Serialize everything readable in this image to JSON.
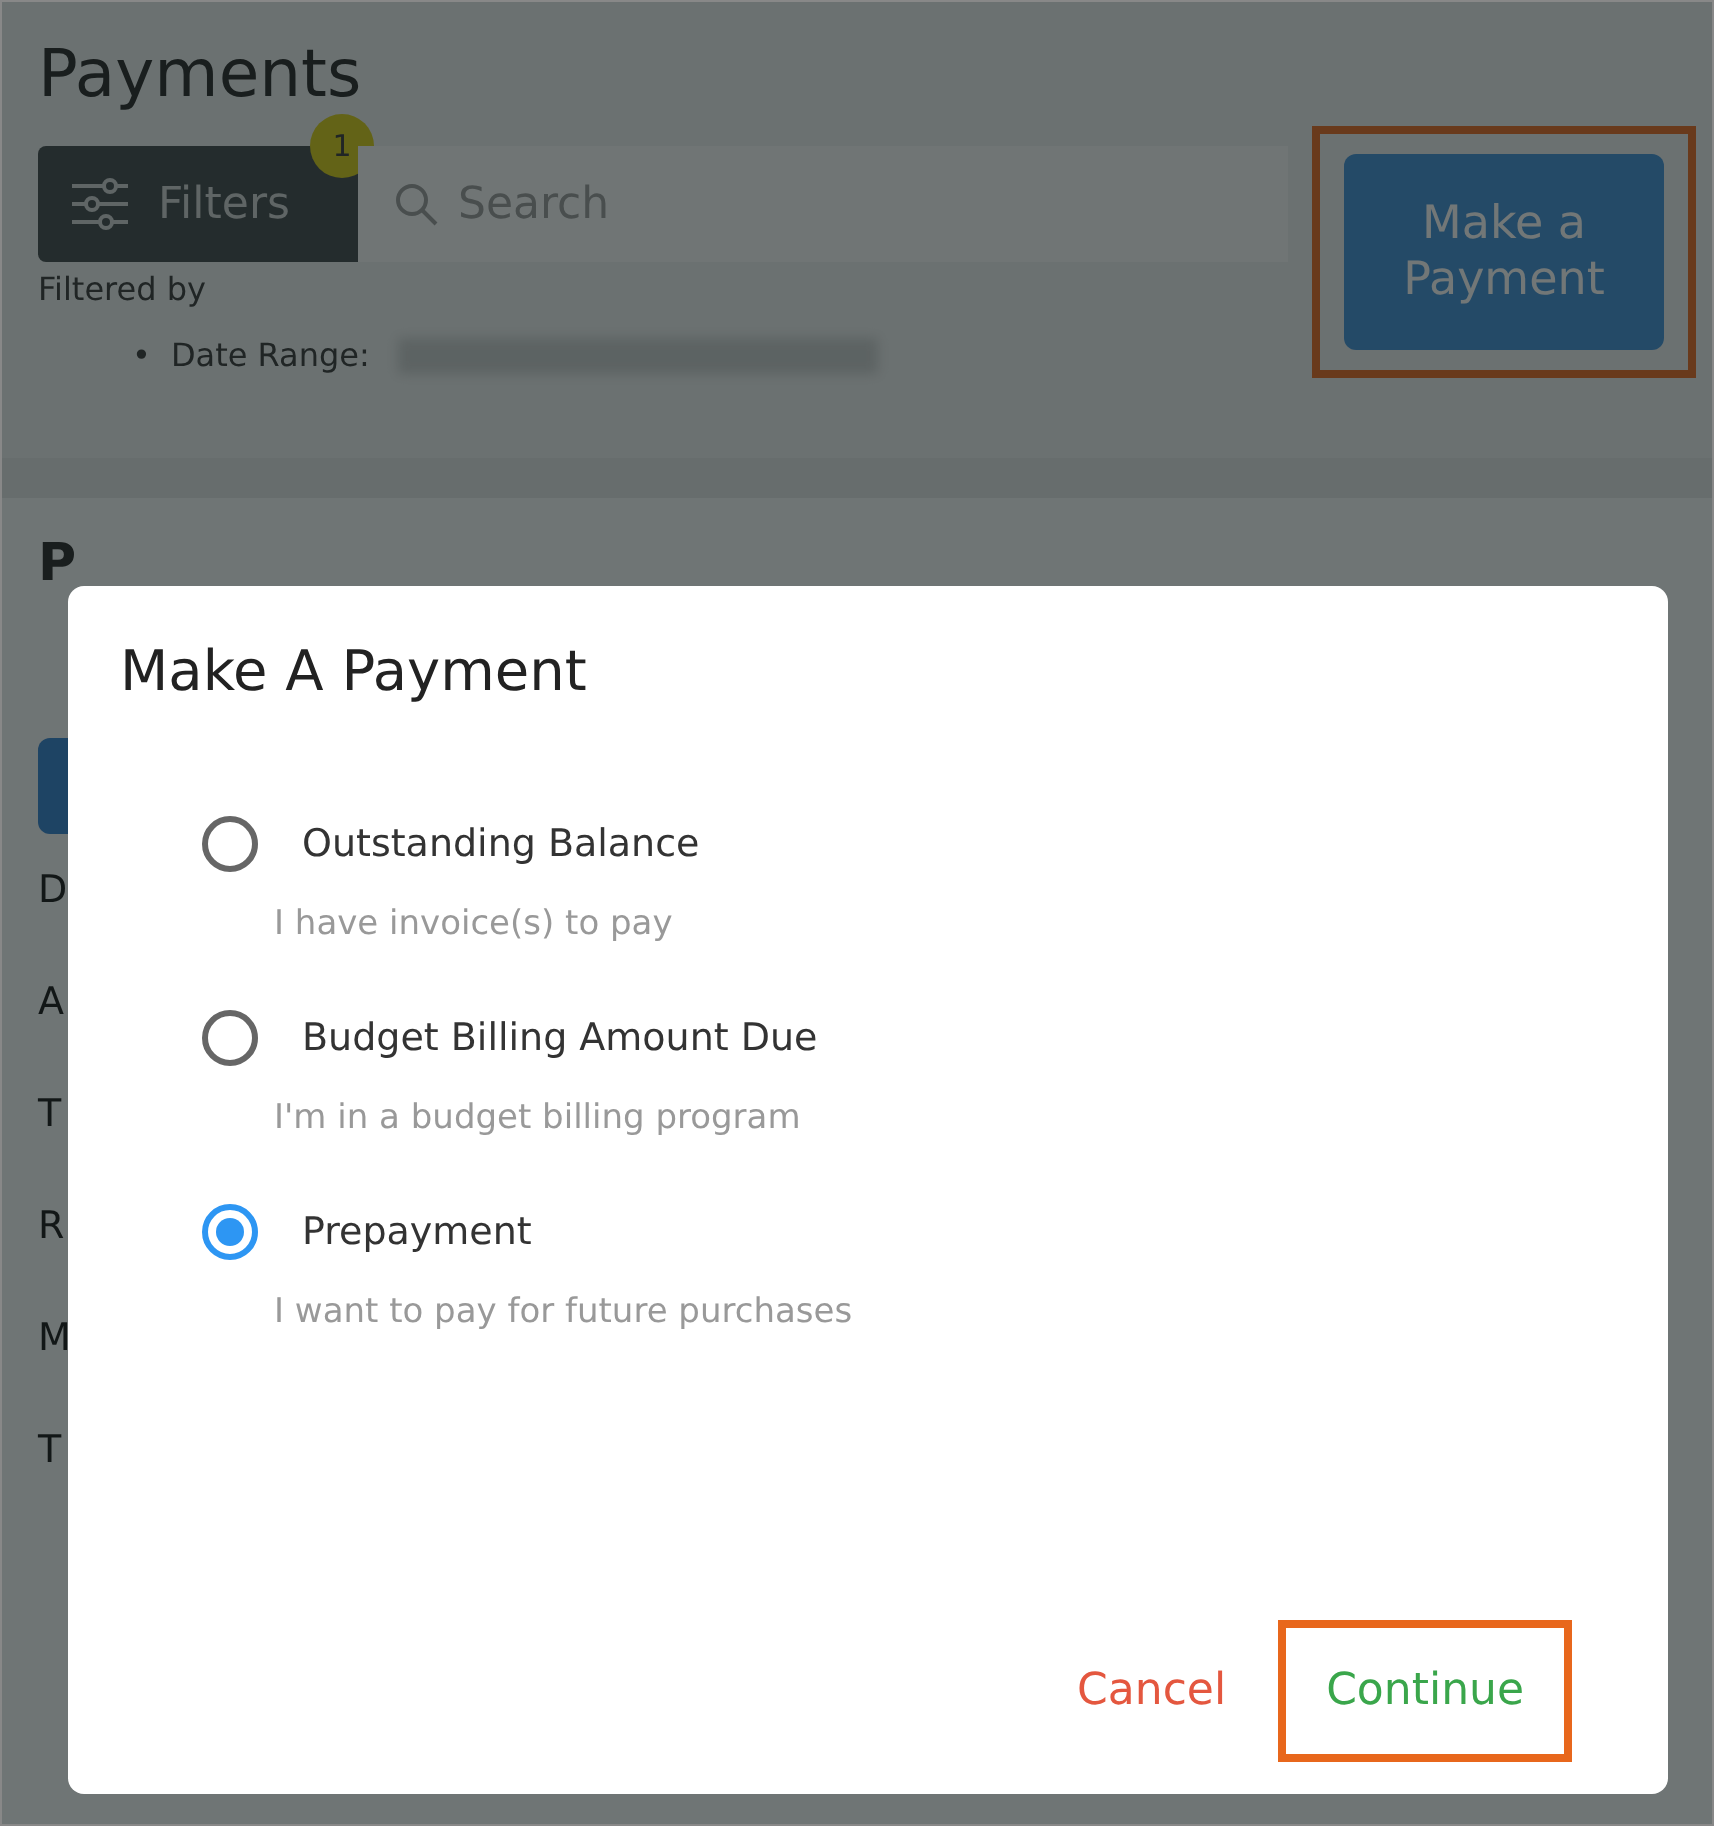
{
  "page": {
    "title": "Payments",
    "filters_button": {
      "label": "Filters",
      "badge": "1"
    },
    "search": {
      "placeholder": "Search"
    },
    "make_payment_button": {
      "label": "Make a Payment",
      "highlighted": true
    },
    "filtered_by": "Filtered by",
    "filter_items": [
      {
        "marker": "•",
        "label": "Date Range:"
      }
    ],
    "panel": {
      "title": "P",
      "rows": [
        "D",
        "A",
        "T",
        "R",
        "M",
        "T"
      ]
    }
  },
  "dialog": {
    "title": "Make A Payment",
    "options": [
      {
        "label": "Outstanding Balance",
        "description": "I have invoice(s) to pay",
        "selected": false
      },
      {
        "label": "Budget Billing Amount Due",
        "description": "I'm in a budget billing program",
        "selected": false
      },
      {
        "label": "Prepayment",
        "description": "I want to pay for future purchases",
        "selected": true
      }
    ],
    "cancel": "Cancel",
    "continue": {
      "label": "Continue",
      "highlighted": true
    }
  }
}
